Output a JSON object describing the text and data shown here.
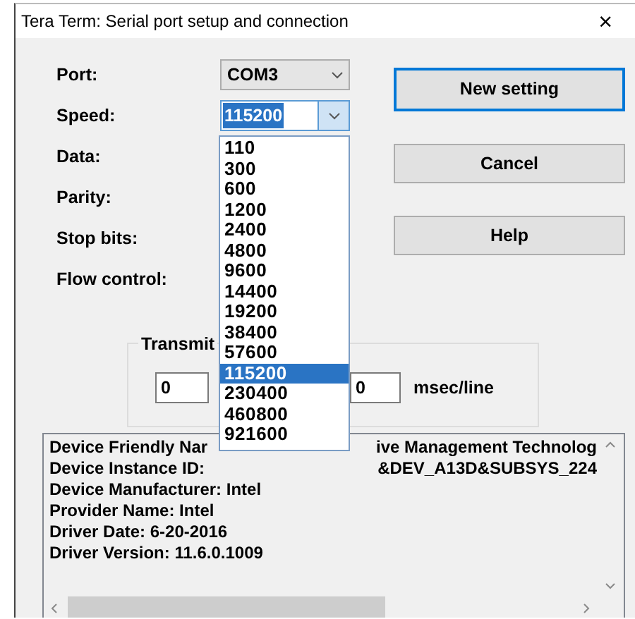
{
  "window": {
    "title": "Tera Term: Serial port setup and connection",
    "close": "×"
  },
  "fields": [
    {
      "label": "Port:",
      "kind": "combo",
      "value": "COM3",
      "focused": false
    },
    {
      "label": "Speed:",
      "kind": "combo",
      "value": "115200",
      "focused": true
    },
    {
      "label": "Data:",
      "kind": "label"
    },
    {
      "label": "Parity:",
      "kind": "label"
    },
    {
      "label": "Stop bits:",
      "kind": "label"
    },
    {
      "label": "Flow control:",
      "kind": "label"
    }
  ],
  "buttons": [
    {
      "label": "New setting",
      "default": true
    },
    {
      "label": "Cancel",
      "default": false
    },
    {
      "label": "Help",
      "default": false
    }
  ],
  "transmit": {
    "legend": "Transmit",
    "inputs": [
      {
        "value": "0"
      },
      {
        "value": "0"
      }
    ],
    "unit": "msec/line"
  },
  "speed_list": [
    {
      "label": "110",
      "selected": false
    },
    {
      "label": "300",
      "selected": false
    },
    {
      "label": "600",
      "selected": false
    },
    {
      "label": "1200",
      "selected": false
    },
    {
      "label": "2400",
      "selected": false
    },
    {
      "label": "4800",
      "selected": false
    },
    {
      "label": "9600",
      "selected": false
    },
    {
      "label": "14400",
      "selected": false
    },
    {
      "label": "19200",
      "selected": false
    },
    {
      "label": "38400",
      "selected": false
    },
    {
      "label": "57600",
      "selected": false
    },
    {
      "label": "115200",
      "selected": true
    },
    {
      "label": "230400",
      "selected": false
    },
    {
      "label": "460800",
      "selected": false
    },
    {
      "label": "921600",
      "selected": false
    }
  ],
  "info": {
    "lines": [
      {
        "segments": [
          "Device Friendly Nar",
          "ive Management Technolog"
        ]
      },
      {
        "segments": [
          "Device Instance ID:",
          "&DEV_A13D&SUBSYS_224"
        ]
      },
      {
        "segments": [
          "Device Manufacturer: Intel"
        ]
      },
      {
        "segments": [
          "Provider Name: Intel"
        ]
      },
      {
        "segments": [
          "Driver Date: 6-20-2016"
        ]
      },
      {
        "segments": [
          "Driver Version: 11.6.0.1009"
        ]
      }
    ]
  }
}
